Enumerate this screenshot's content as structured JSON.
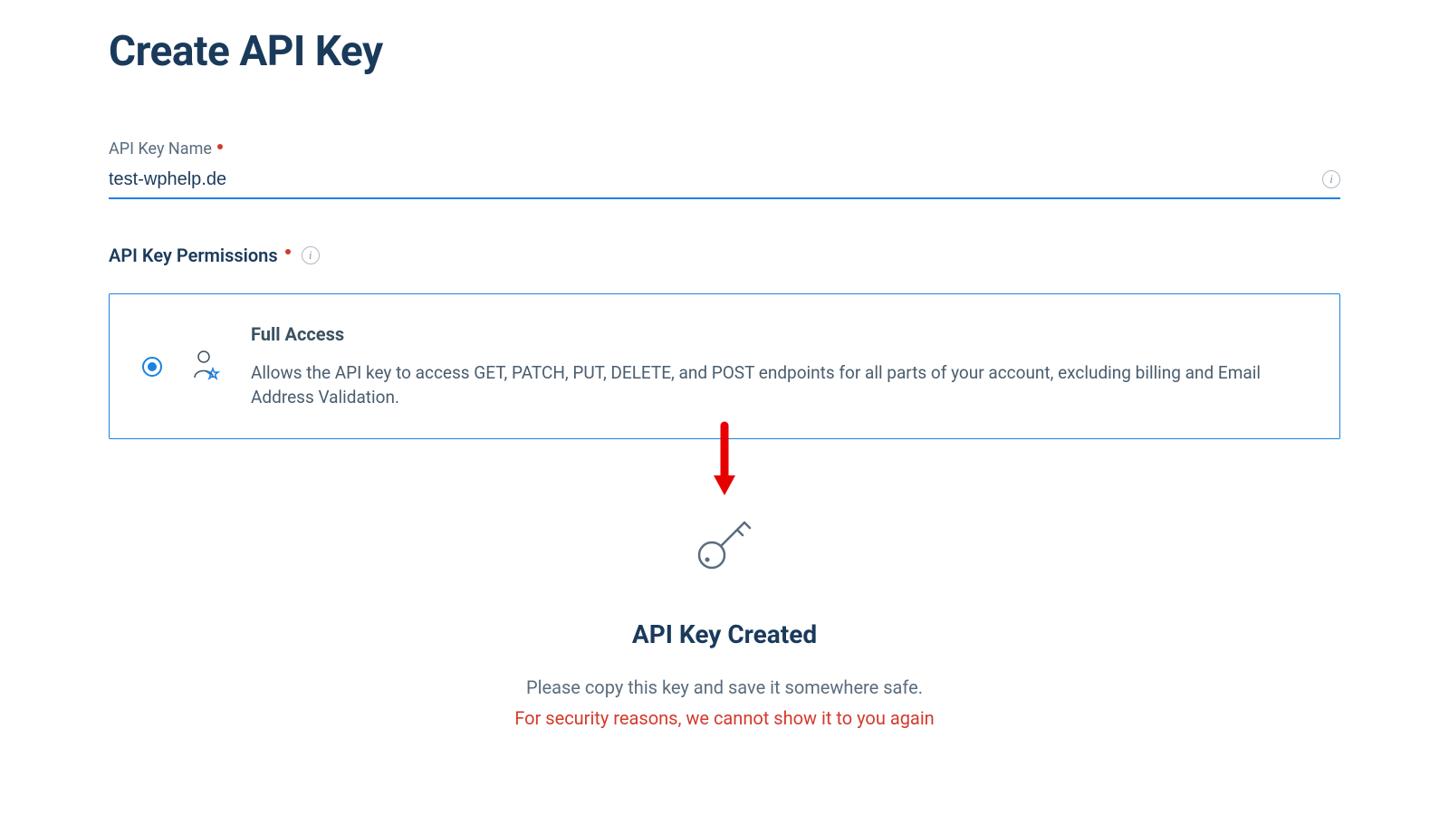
{
  "page": {
    "title": "Create API Key"
  },
  "name_field": {
    "label": "API Key Name",
    "value": "test-wphelp.de"
  },
  "permissions": {
    "label": "API Key Permissions",
    "option": {
      "title": "Full Access",
      "description": "Allows the API key to access GET, PATCH, PUT, DELETE, and POST endpoints for all parts of your account, excluding billing and Email Address Validation."
    }
  },
  "created": {
    "title": "API Key Created",
    "message": "Please copy this key and save it somewhere safe.",
    "warning": "For security reasons, we cannot show it to you again"
  }
}
